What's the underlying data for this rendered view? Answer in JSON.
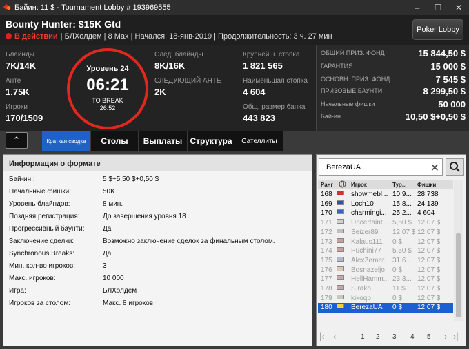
{
  "window": {
    "title": "Байин: 11 $ - Tournament Lobby # 193969555",
    "min": "–",
    "max": "☐",
    "close": "✕"
  },
  "header": {
    "title": "Bounty Hunter: $15K Gtd",
    "status": "В действии",
    "details": "| БЛХолдем | 8 Max | Начался: 18-янв-2019 | Продолжительность: 3 ч. 27 мин",
    "poker_lobby": "Poker Lobby"
  },
  "stats": {
    "blinds_label": "Блайнды",
    "blinds": "7K/14K",
    "ante_label": "Анте",
    "ante": "1.75K",
    "players_label": "Игроки",
    "players": "170/1509",
    "next_blinds_label": "След. блайнды",
    "next_blinds": "8K/16K",
    "next_ante_label": "СЛЕДУЮЩИЙ АНТЕ",
    "next_ante": "2K",
    "largest_label": "Крупнейш. стопка",
    "largest": "1 821 565",
    "smallest_label": "Наименьшая стопка",
    "smallest": "4 604",
    "bank_label": "Общ. размер банка",
    "bank": "443 823"
  },
  "timer": {
    "level": "Уровень 24",
    "time": "06:21",
    "to_break": "TO BREAK",
    "break_time": "26:52"
  },
  "prize": [
    {
      "label": "ОБЩИЙ ПРИЗ. ФОНД",
      "value": "15 844,50 $"
    },
    {
      "label": "ГАРАНТИЯ",
      "value": "15 000 $"
    },
    {
      "label": "ОСНОВН. ПРИЗ. ФОНД",
      "value": "7 545 $"
    },
    {
      "label": "ПРИЗОВЫЕ БАУНТИ",
      "value": "8 299,50 $"
    },
    {
      "label": "Начальные фишки",
      "value": "50 000"
    },
    {
      "label": "Бай-ин",
      "value": "10,50 $+0,50 $"
    }
  ],
  "tabs": {
    "collapse": "⌃",
    "summary": "Краткая сводка",
    "tables": "Столы",
    "payouts": "Выплаты",
    "structure": "Структура",
    "satellites": "Сателлиты"
  },
  "info": {
    "heading": "Информация о формате",
    "rows": [
      {
        "k": "Бай-ин :",
        "v": "5 $+5,50 $+0,50 $"
      },
      {
        "k": "Начальные фишки:",
        "v": "50K"
      },
      {
        "k": "Уровень блайндов:",
        "v": "8 мин."
      },
      {
        "k": "Поздняя регистрация:",
        "v": "До завершения уровня 18"
      },
      {
        "k": "Прогрессивный баунти:",
        "v": "Да"
      },
      {
        "k": "Заключение сделки:",
        "v": "Возможно заключение сделок за финальным столом."
      },
      {
        "k": "Synchronous Breaks:",
        "v": "Да"
      },
      {
        "k": "Мин. кол-во игроков:",
        "v": "3"
      },
      {
        "k": "Макс. игроков:",
        "v": "10 000"
      },
      {
        "k": "Игра:",
        "v": "БЛХолдем"
      },
      {
        "k": "Игроков за столом:",
        "v": "Макс. 8 игроков"
      }
    ]
  },
  "players": {
    "search": "BerezaUA",
    "clear": "✕",
    "headers": {
      "rank": "Ранг",
      "player": "Игрок",
      "tour": "Тур...",
      "chips": "Фишки"
    },
    "rows": [
      {
        "rank": "168",
        "name": "showmebl...",
        "tour": "10,9...",
        "chips": "28 738",
        "flag": "#d43030"
      },
      {
        "rank": "169",
        "name": "Loch10",
        "tour": "15,8...",
        "chips": "24 139",
        "flag": "#3050b0"
      },
      {
        "rank": "170",
        "name": "charmingi...",
        "tour": "25,2...",
        "chips": "4 604",
        "flag": "#4060c0"
      },
      {
        "rank": "171",
        "name": "Uncertaint...",
        "tour": "5,50 $",
        "chips": "12,07 $",
        "flag": "#d0d0d0"
      },
      {
        "rank": "172",
        "name": "Seizer89",
        "tour": "12,07 $",
        "chips": "12,07 $",
        "flag": "#c0c0c0"
      },
      {
        "rank": "173",
        "name": "Kalaus111",
        "tour": "0 $",
        "chips": "12,07 $",
        "flag": "#c8a0a0"
      },
      {
        "rank": "174",
        "name": "Puchini77",
        "tour": "5,50 $",
        "chips": "12,07 $",
        "flag": "#c8a0a0"
      },
      {
        "rank": "175",
        "name": "AlexZemer",
        "tour": "31,6...",
        "chips": "12,07 $",
        "flag": "#b0b8d0"
      },
      {
        "rank": "176",
        "name": "Bosnazeljo",
        "tour": "0 $",
        "chips": "12,07 $",
        "flag": "#d8c8b8"
      },
      {
        "rank": "177",
        "name": "HellHamm...",
        "tour": "23,3...",
        "chips": "12,07 $",
        "flag": "#c8a8a8"
      },
      {
        "rank": "178",
        "name": "S.rako",
        "tour": "11 $",
        "chips": "12,07 $",
        "flag": "#c0a8b0"
      },
      {
        "rank": "179",
        "name": "kikoqb",
        "tour": "0 $",
        "chips": "12,07 $",
        "flag": "#c8c8c0"
      },
      {
        "rank": "180",
        "name": "BerezaUA",
        "tour": "0 $",
        "chips": "12,07 $",
        "flag": "#f0d040"
      }
    ],
    "pages": [
      "1",
      "2",
      "3",
      "4",
      "5"
    ]
  }
}
